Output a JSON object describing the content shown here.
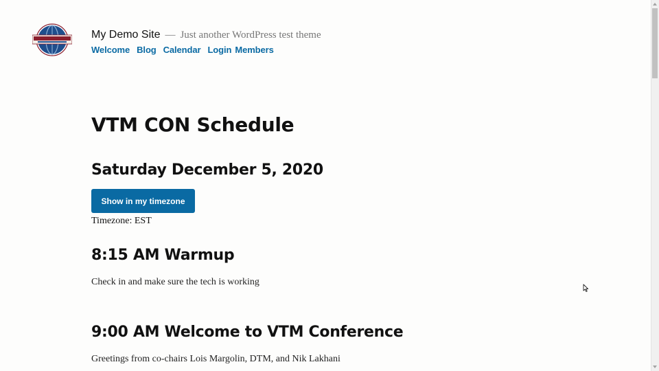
{
  "site": {
    "logo_name": "toastmasters-logo",
    "title": "My Demo Site",
    "separator": "—",
    "description": "Just another WordPress test theme"
  },
  "nav": {
    "items": [
      {
        "label": "Welcome"
      },
      {
        "label": "Blog"
      },
      {
        "label": "Calendar"
      },
      {
        "label": "Login"
      },
      {
        "label": "Members"
      }
    ]
  },
  "page": {
    "title": "VTM CON Schedule",
    "date_heading": "Saturday December 5, 2020",
    "timezone_button": "Show in my timezone",
    "timezone_label": "Timezone: EST"
  },
  "sessions": [
    {
      "title": "8:15 AM Warmup",
      "description": "Check in and make sure the tech is working"
    },
    {
      "title": "9:00 AM Welcome to VTM Conference",
      "description": "Greetings from co-chairs Lois Margolin, DTM, and Nik Lakhani"
    }
  ],
  "colors": {
    "link": "#0a6aa3",
    "button_bg": "#0a6aa3",
    "text": "#111111",
    "muted": "#767676",
    "logo_blue": "#1f4e8c",
    "logo_maroon": "#8b1f2e"
  }
}
